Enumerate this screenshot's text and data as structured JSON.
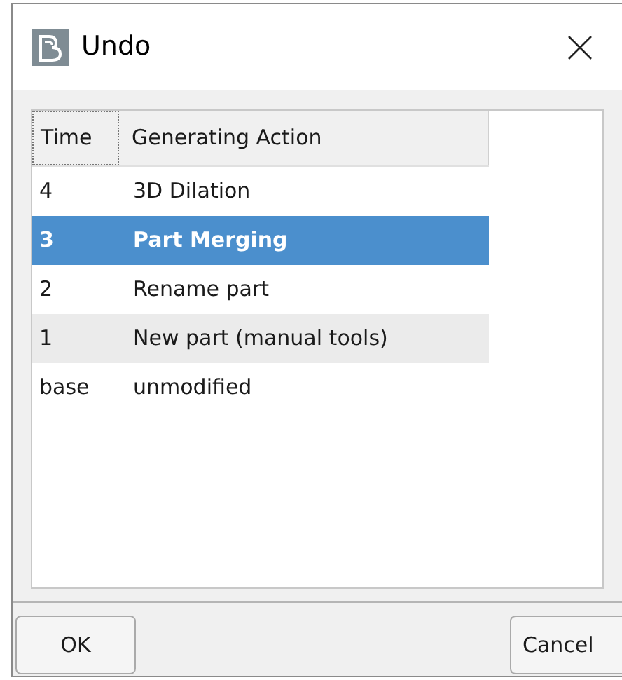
{
  "window": {
    "title": "Undo"
  },
  "table": {
    "columns": [
      "Time",
      "Generating Action"
    ],
    "rows": [
      {
        "time": "4",
        "action": "3D Dilation",
        "selected": false
      },
      {
        "time": "3",
        "action": "Part Merging",
        "selected": true
      },
      {
        "time": "2",
        "action": "Rename part",
        "selected": false
      },
      {
        "time": "1",
        "action": "New part (manual tools)",
        "selected": false
      },
      {
        "time": "base",
        "action": "unmodified",
        "selected": false
      }
    ]
  },
  "buttons": [
    "OK",
    "Cancel"
  ]
}
